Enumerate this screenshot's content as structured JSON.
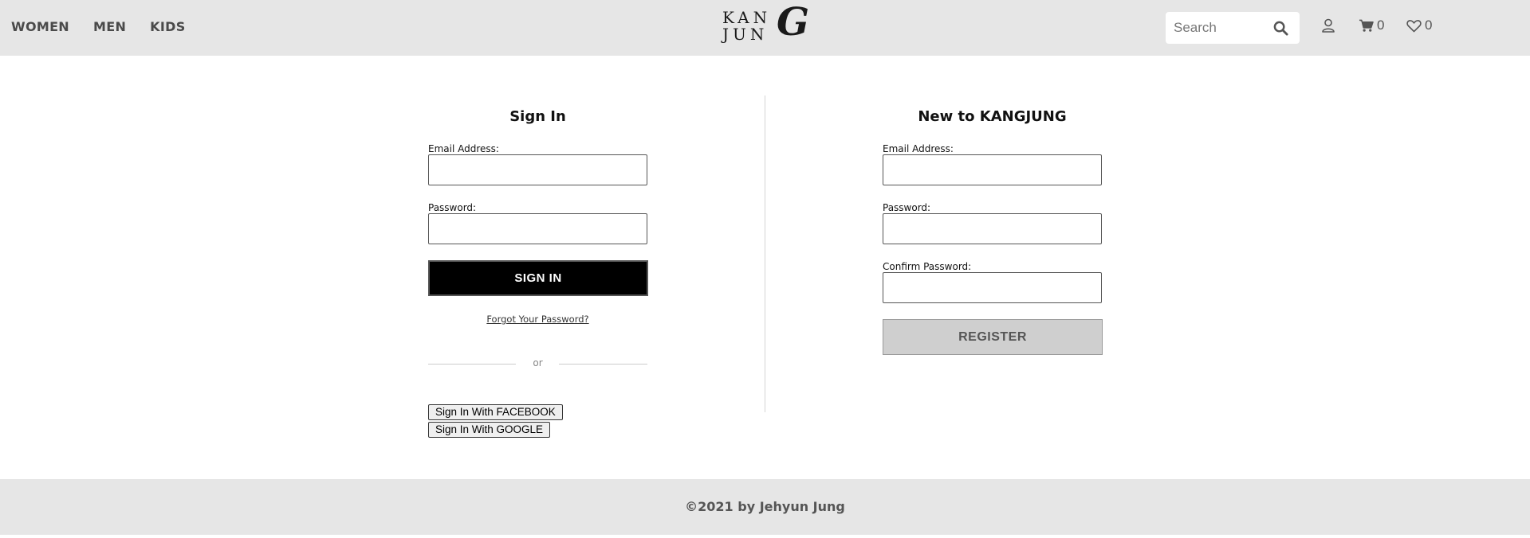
{
  "header": {
    "nav": [
      {
        "label": "WOMEN"
      },
      {
        "label": "MEN"
      },
      {
        "label": "KIDS"
      }
    ],
    "logo": {
      "line1": "KAN",
      "line2": "JUN",
      "big_letter": "G"
    },
    "search": {
      "placeholder": "Search",
      "icon": "search-icon"
    },
    "user_icon": "user-icon",
    "cart": {
      "icon": "cart-icon",
      "count": "0"
    },
    "wishlist": {
      "icon": "heart-icon",
      "count": "0"
    }
  },
  "signin": {
    "title": "Sign In",
    "email_label": "Email Address:",
    "password_label": "Password:",
    "button_label": "SIGN IN",
    "forgot_label": "Forgot Your Password?",
    "or_label": "or",
    "facebook_label": "Sign In With FACEBOOK",
    "google_label": "Sign In With GOOGLE"
  },
  "register": {
    "title": "New to KANGJUNG",
    "email_label": "Email Address:",
    "password_label": "Password:",
    "confirm_label": "Confirm Password:",
    "button_label": "REGISTER"
  },
  "footer": {
    "text": "©2021 by Jehyun Jung"
  }
}
